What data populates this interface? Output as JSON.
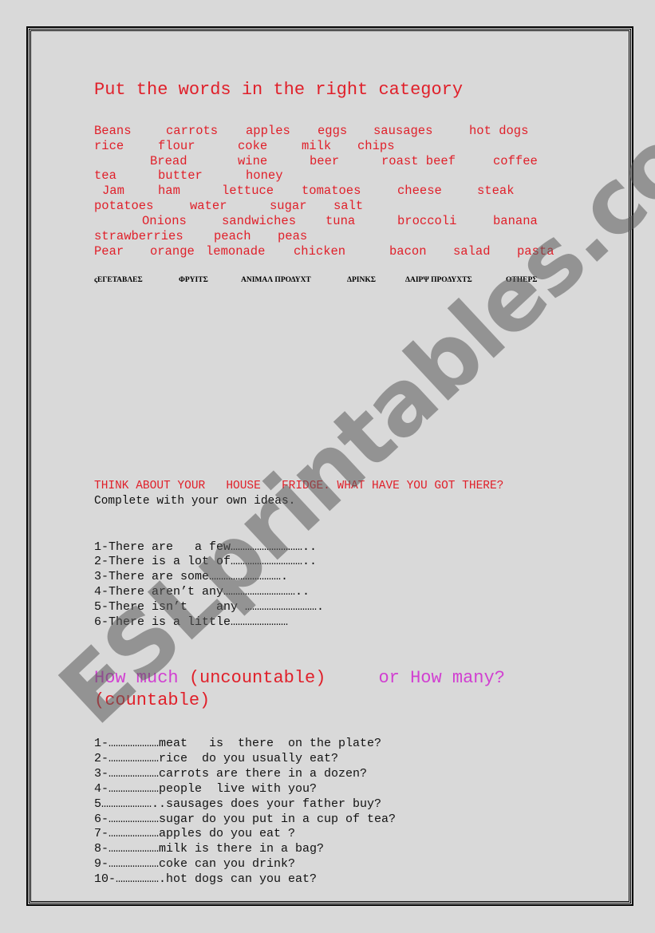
{
  "section1": {
    "title": "Put the words in the right category",
    "word_rows": [
      [
        "Beans",
        "carrots",
        "apples",
        "eggs",
        "sausages",
        "hot dogs"
      ],
      [
        "rice",
        "flour",
        "coke",
        "milk",
        "chips"
      ],
      [
        "Bread",
        "wine",
        "beer",
        "roast beef",
        "coffee"
      ],
      [
        "tea",
        "butter",
        "honey"
      ],
      [
        "Jam",
        "ham",
        "lettuce",
        "tomatoes",
        "cheese",
        "steak"
      ],
      [
        "potatoes",
        "water",
        "sugar",
        "salt"
      ],
      [
        "Onions",
        "sandwiches",
        "tuna",
        "broccoli",
        "banana"
      ],
      [
        "strawberries",
        "peach",
        "peas"
      ],
      [
        "Pear",
        "orange",
        "lemonade",
        "chicken",
        "bacon",
        "salad",
        "pasta"
      ]
    ],
    "categories": [
      "ςΕΓΕΤΑΒΛΕΣ",
      "ΦΡΥΙΤΣ",
      "ΑΝΙΜΑΛ ΠΡΟΔΥΧΤ",
      "ΔΡΙΝΚΣ",
      "ΔΑΙΡΨ ΠΡΟΔΥΧΤΣ",
      "ΟΤΗΕΡΣ"
    ]
  },
  "section2": {
    "heading": "THINK ABOUT YOUR   HOUSE   FRIDGE. WHAT HAVE YOU GOT THERE?",
    "instruction": "Complete with your own ideas.",
    "items": [
      "1-There are   a few…………………………..",
      "2-There is a lot of…………………………..",
      "3-There are some………………………….",
      "4-There aren’t any…………………………..",
      "5-There isn’t    any ………………………….",
      "6-There is a little……………………"
    ]
  },
  "section3": {
    "heading_how_much": "How much",
    "heading_uncountable": " (uncountable)",
    "heading_or_how_many": "     or How many?",
    "heading_countable": "(countable)",
    "items": [
      "1-…………………meat   is  there  on the plate?",
      "2-…………………rice  do you usually eat?",
      "3-…………………carrots are there in a dozen?",
      "4-…………………people  live with you?",
      "5…………………..sausages does your father buy?",
      "6-…………………sugar do you put in a cup of tea?",
      "7-…………………apples do you eat ?",
      "8-…………………milk is there in a bag?",
      "9-…………………coke can you drink?",
      "10-……………….hot dogs can you eat?"
    ]
  },
  "watermark": "ESLprintables.com",
  "colors": {
    "background": "#d9d9d9",
    "red_text": "#e0202a",
    "magenta_text": "#d13fd1",
    "black_text": "#111111"
  }
}
